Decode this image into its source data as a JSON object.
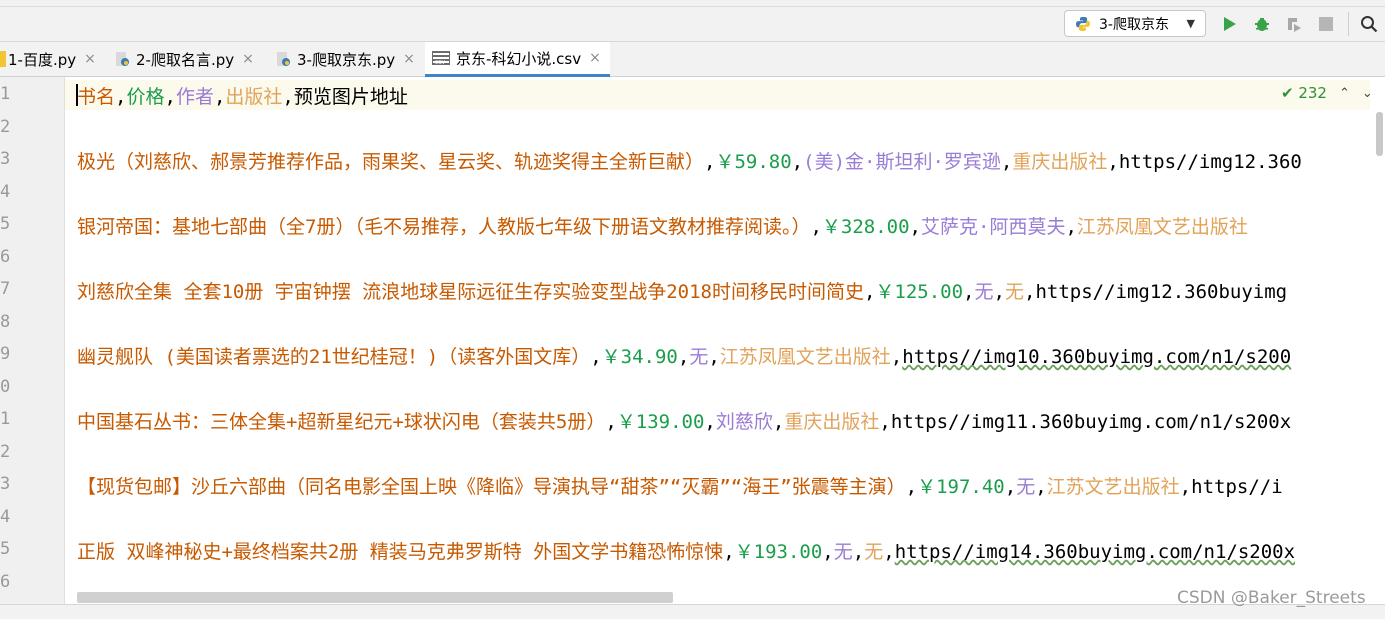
{
  "toolbar": {
    "run_config_label": "3-爬取京东",
    "dropdown_arrow": "▼",
    "buttons": [
      "run-icon",
      "debug-icon",
      "coverage-icon",
      "stop-icon",
      "search-icon"
    ]
  },
  "tabs": [
    {
      "label": "1-百度.py",
      "close": "×",
      "icon": "python-file-icon"
    },
    {
      "label": "2-爬取名言.py",
      "close": "×",
      "icon": "python-file-icon"
    },
    {
      "label": "3-爬取京东.py",
      "close": "×",
      "icon": "python-file-icon"
    },
    {
      "label": "京东-科幻小说.csv",
      "close": "×",
      "icon": "csv-file-icon",
      "active": true
    }
  ],
  "line_numbers": [
    "1",
    "2",
    "3",
    "4",
    "5",
    "6",
    "7",
    "8",
    "9",
    "0",
    "1",
    "2",
    "3",
    "4",
    "5",
    "6"
  ],
  "inspection": {
    "count": "✔ 232",
    "up": "⌃",
    "down": "⌄"
  },
  "rows": {
    "r1": {
      "c1": "书名",
      "s1": ",",
      "c2": "价格",
      "s2": ",",
      "c3": "作者",
      "s3": ",",
      "c4": "出版社",
      "s4": ",",
      "c5": "预览图片地址"
    },
    "r3": {
      "c1": "极光（刘慈欣、郝景芳推荐作品，雨果奖、星云奖、轨迹奖得主全新巨献）",
      "s1": ",",
      "c2": "￥59.80",
      "s2": ",",
      "c3": "(美)金·斯坦利·罗宾逊",
      "s3": ",",
      "c4": "重庆出版社",
      "s4": ",",
      "c5": "https//img12.360"
    },
    "r5": {
      "c1": "银河帝国：基地七部曲（全7册）（毛不易推荐，人教版七年级下册语文教材推荐阅读。）",
      "s1": ",",
      "c2": "￥328.00",
      "s2": ",",
      "c3": "艾萨克·阿西莫夫",
      "s3": ",",
      "c4": "江苏凤凰文艺出版社",
      "s4": "",
      "c5": ""
    },
    "r7": {
      "c1": "刘慈欣全集 全套10册 宇宙钟摆 流浪地球星际远征生存实验变型战争2018时间移民时间简史",
      "s1": ",",
      "c2": "￥125.00",
      "s2": ",",
      "c3": "无",
      "s3": ",",
      "c4": "无",
      "s4": ",",
      "c5": "https//img12.360buyimg"
    },
    "r9": {
      "c1": "幽灵舰队 (美国读者票选的21世纪桂冠！)（读客外国文库）",
      "s1": ",",
      "c2": "￥34.90",
      "s2": ",",
      "c3": "无",
      "s3": ",",
      "c4": "江苏凤凰文艺出版社",
      "s4": ",",
      "c5": "https//img10.360buyimg.com/n1/s200"
    },
    "r11": {
      "c1": "中国基石丛书：三体全集+超新星纪元+球状闪电（套装共5册）",
      "s1": ",",
      "c2": "￥139.00",
      "s2": ",",
      "c3": "刘慈欣",
      "s3": ",",
      "c4": "重庆出版社",
      "s4": ",",
      "c5": "https//img11.360buyimg.com/n1/s200x"
    },
    "r13": {
      "c1": "【现货包邮】沙丘六部曲（同名电影全国上映《降临》导演执导“甜茶”“灭霸”“海王”张震等主演）",
      "s1": ",",
      "c2": "￥197.40",
      "s2": ",",
      "c3": "无",
      "s3": ",",
      "c4": "江苏文艺出版社",
      "s4": ",",
      "c5": "https//i"
    },
    "r15": {
      "c1": "正版 双峰神秘史+最终档案共2册 精装马克弗罗斯特 外国文学书籍恐怖惊悚",
      "s1": ",",
      "c2": "￥193.00",
      "s2": ",",
      "c3": "无",
      "s3": ",",
      "c4": "无",
      "s4": ",",
      "c5": "https//img14.360buyimg.com/n1/s200x"
    }
  },
  "watermark": "CSDN @Baker_Streets",
  "colors": {
    "col1": "#c75a00",
    "col2": "#1b9e4b",
    "col3": "#9a7cd6",
    "col4": "#e1a35a",
    "col5": "#000000",
    "tab_underline": "#4083c9"
  }
}
